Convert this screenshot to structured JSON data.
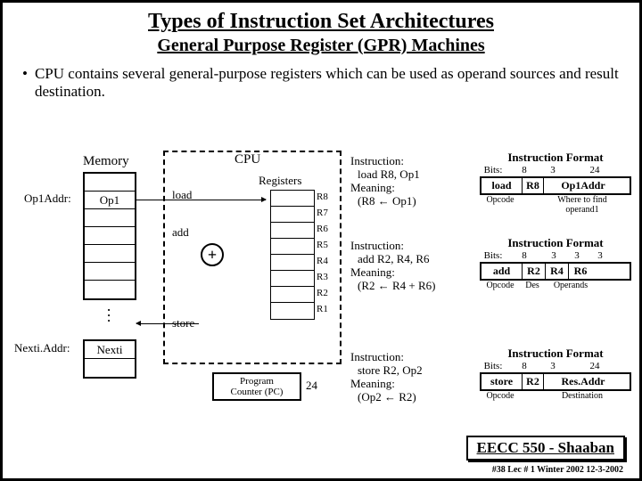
{
  "title": "Types of Instruction Set Architectures",
  "subtitle": "General Purpose Register (GPR) Machines",
  "bullet": "CPU contains several general-purpose registers which can be used as operand sources and result destination.",
  "mem": {
    "label": "Memory",
    "op1addr": "Op1Addr:",
    "op1": "Op1",
    "nextiaddr": "Nexti.Addr:",
    "nexti": "Nexti"
  },
  "cpu": {
    "label": "CPU",
    "registers_title": "Registers",
    "load": "load",
    "add": "add",
    "store": "store",
    "regs": [
      "R8",
      "R7",
      "R6",
      "R5",
      "R4",
      "R3",
      "R2",
      "R1"
    ],
    "pc": "Program\nCounter (PC)",
    "pcval": "24"
  },
  "instr1": {
    "l1": "Instruction:",
    "l2": "  load R8, Op1",
    "l3": "Meaning:",
    "l4": "  (R8 ← Op1)"
  },
  "instr2": {
    "l1": "Instruction:",
    "l2": "  add R2, R4, R6",
    "l3": "Meaning:",
    "l4": "  (R2 ← R4 + R6)"
  },
  "instr3": {
    "l1": "Instruction:",
    "l2": "  store R2, Op2",
    "l3": "Meaning:",
    "l4": "  (Op2 ← R2)"
  },
  "fmt1": {
    "title": "Instruction Format",
    "bits_lbl": "Bits:",
    "bits": [
      "8",
      "3",
      "24"
    ],
    "cells": [
      "load",
      "R8",
      "Op1Addr"
    ],
    "subs": [
      "Opcode",
      "",
      "Where to find\noperand1"
    ]
  },
  "fmt2": {
    "title": "Instruction Format",
    "bits_lbl": "Bits:",
    "bits": [
      "8",
      "3",
      "3",
      "3"
    ],
    "cells": [
      "add",
      "R2",
      "R4",
      "R6"
    ],
    "subs": [
      "Opcode",
      "Des",
      "Operands",
      ""
    ]
  },
  "fmt3": {
    "title": "Instruction Format",
    "bits_lbl": "Bits:",
    "bits": [
      "8",
      "3",
      "24"
    ],
    "cells": [
      "store",
      "R2",
      "Res.Addr"
    ],
    "subs": [
      "Opcode",
      "",
      "Destination"
    ]
  },
  "footer": {
    "course": "EECC 550 - Shaaban",
    "line": "#38  Lec # 1 Winter 2002  12-3-2002"
  }
}
